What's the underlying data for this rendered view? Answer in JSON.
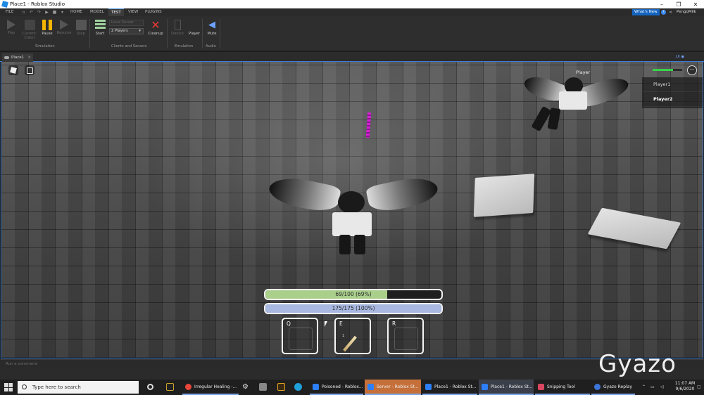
{
  "window": {
    "title": "Place1 - Roblox Studio",
    "min": "–",
    "max": "❐",
    "close": "✕"
  },
  "ribbon_tabs": [
    "FILE",
    "HOME",
    "MODEL",
    "TEST",
    "VIEW",
    "PLUGINS"
  ],
  "active_tab": "TEST",
  "whats_new": "What's New",
  "help": "?",
  "username": "PengoMilk",
  "toolbar": {
    "play": "Play",
    "current_client": "Current: Client",
    "pause": "Pause",
    "resume": "Resume",
    "stop": "Stop",
    "start": "Start",
    "local_server": "Local Server",
    "players_select": "2 Players",
    "cleanup": "Cleanup",
    "device": "Device",
    "player": "Player",
    "mute": "Mute"
  },
  "groups": {
    "simulation": "Simulation",
    "clients_servers": "Clients and Servers",
    "emulation": "Emulation",
    "audio": "Audio"
  },
  "doc_tab": {
    "label": "Place1",
    "close": "✕"
  },
  "ui_toggle": "UI",
  "viewport": {
    "player_tag": "Player",
    "players": [
      "Player1",
      "Player2"
    ],
    "more": "···",
    "health_fraction": 0.69,
    "stamina_fraction": 1.0,
    "health_text": "69/100 (69%)",
    "stamina_text": "175/175 (100%)",
    "hotbar": [
      {
        "key": "Q",
        "count": ""
      },
      {
        "key": "E",
        "count": "1"
      },
      {
        "key": "R",
        "count": ""
      }
    ],
    "colors": {
      "health": "#a9cf8b",
      "stamina": "#a8b8e0"
    }
  },
  "command_bar": {
    "placeholder": "Run a command"
  },
  "watermark": "Gyazo",
  "taskbar": {
    "search_placeholder": "Type here to search",
    "apps": [
      {
        "label": "Irregular Healing -...",
        "color": "#e8463a"
      },
      {
        "label": "Poisoned - Roblox...",
        "color": "#2d7ff9"
      },
      {
        "label": "Server - Roblox St...",
        "color": "#2d7ff9"
      },
      {
        "label": "Place1 - Roblox St...",
        "color": "#2d7ff9"
      },
      {
        "label": "Place1 - Roblox St...",
        "color": "#2d7ff9"
      },
      {
        "label": "Snipping Tool",
        "color": "#d9465f"
      },
      {
        "label": "Gyazo Replay",
        "color": "#3c74d8"
      }
    ],
    "time": "11:07 AM",
    "date": "9/6/2020"
  }
}
